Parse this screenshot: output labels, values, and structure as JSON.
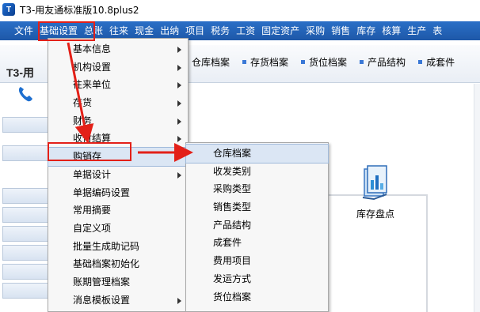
{
  "window": {
    "title": "T3-用友通标准版10.8plus2",
    "app_icon_text": "T"
  },
  "menubar": {
    "items": [
      "文件",
      "基础设置",
      "总账",
      "往来",
      "现金",
      "出纳",
      "项目",
      "税务",
      "工资",
      "固定资产",
      "采购",
      "销售",
      "库存",
      "核算",
      "生产",
      "表"
    ]
  },
  "logo": {
    "text": "T3-",
    "suffix": "用"
  },
  "toolbar_nav": {
    "items": [
      "仓库档案",
      "存货档案",
      "货位档案",
      "产品结构",
      "成套件"
    ]
  },
  "basic_settings_menu": {
    "items": [
      {
        "label": "基本信息",
        "submenu": true
      },
      {
        "label": "机构设置",
        "submenu": true
      },
      {
        "label": "往来单位",
        "submenu": true
      },
      {
        "label": "存货",
        "submenu": true
      },
      {
        "label": "财务",
        "submenu": true
      },
      {
        "label": "收付结算",
        "submenu": true
      },
      {
        "label": "购销存",
        "submenu": true,
        "highlighted": true
      },
      {
        "label": "单据设计",
        "submenu": true
      },
      {
        "label": "单据编码设置",
        "submenu": false
      },
      {
        "label": "常用摘要",
        "submenu": false
      },
      {
        "label": "自定义项",
        "submenu": false
      },
      {
        "label": "批量生成助记码",
        "submenu": false
      },
      {
        "label": "基础档案初始化",
        "submenu": false
      },
      {
        "label": "账期管理档案",
        "submenu": false
      },
      {
        "label": "消息模板设置",
        "submenu": true
      }
    ]
  },
  "purchase_sales_submenu": {
    "items": [
      {
        "label": "仓库档案",
        "highlighted": true
      },
      {
        "label": "收发类别"
      },
      {
        "label": "采购类型"
      },
      {
        "label": "销售类型"
      },
      {
        "label": "产品结构"
      },
      {
        "label": "成套件"
      },
      {
        "label": "费用项目"
      },
      {
        "label": "发运方式"
      },
      {
        "label": "货位档案"
      }
    ]
  },
  "workspace": {
    "inventory_card_label": "库存盘点"
  },
  "colors": {
    "menubar": "#1e58a8",
    "annotation_red": "#e32018",
    "highlight": "#dbe6f4"
  },
  "icons": {
    "phone": "phone-icon",
    "inventory": "inventory-check-icon",
    "submenu_arrow": "triangle-right-icon"
  }
}
